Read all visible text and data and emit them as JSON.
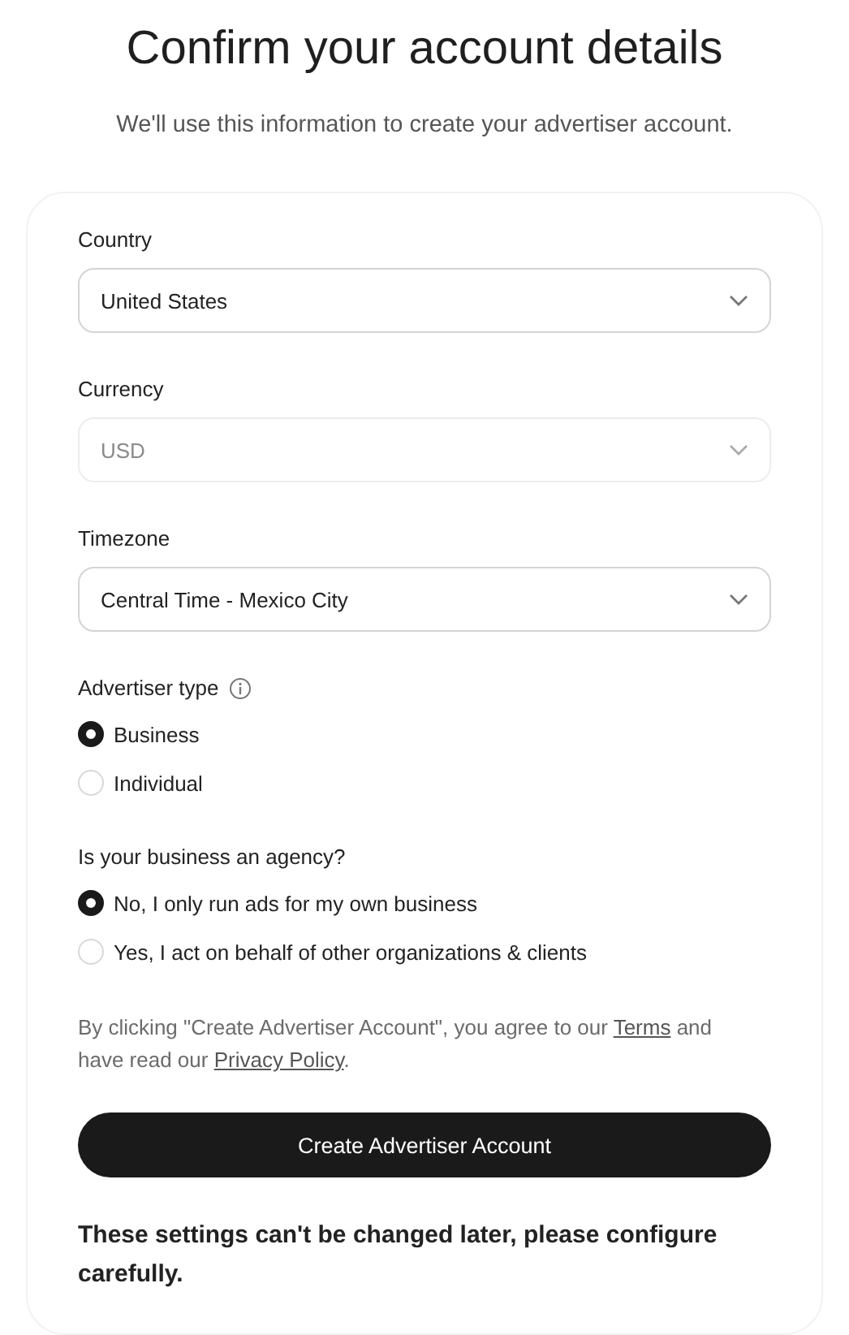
{
  "title": "Confirm your account details",
  "subtitle": "We'll use this information to create your advertiser account.",
  "fields": [
    {
      "label": "Country",
      "value": "United States",
      "disabled": false
    },
    {
      "label": "Currency",
      "value": "USD",
      "disabled": true
    },
    {
      "label": "Timezone",
      "value": "Central Time - Mexico City",
      "disabled": false
    }
  ],
  "radio_groups": [
    {
      "label": "Advertiser type",
      "has_info": true,
      "options": [
        {
          "label": "Business",
          "selected": true
        },
        {
          "label": "Individual",
          "selected": false
        }
      ]
    },
    {
      "label": "Is your business an agency?",
      "has_info": false,
      "options": [
        {
          "label": "No, I only run ads for my own business",
          "selected": true
        },
        {
          "label": "Yes, I act on behalf of other organizations & clients",
          "selected": false
        }
      ]
    }
  ],
  "legal": {
    "before": "By clicking \"Create Advertiser Account\", you agree to our",
    "terms_link": "Terms",
    "middle": "and have read our",
    "privacy_link": "Privacy Policy",
    "end": "."
  },
  "button": "Create Advertiser Account",
  "warning": "These settings can't be changed later, please configure carefully."
}
